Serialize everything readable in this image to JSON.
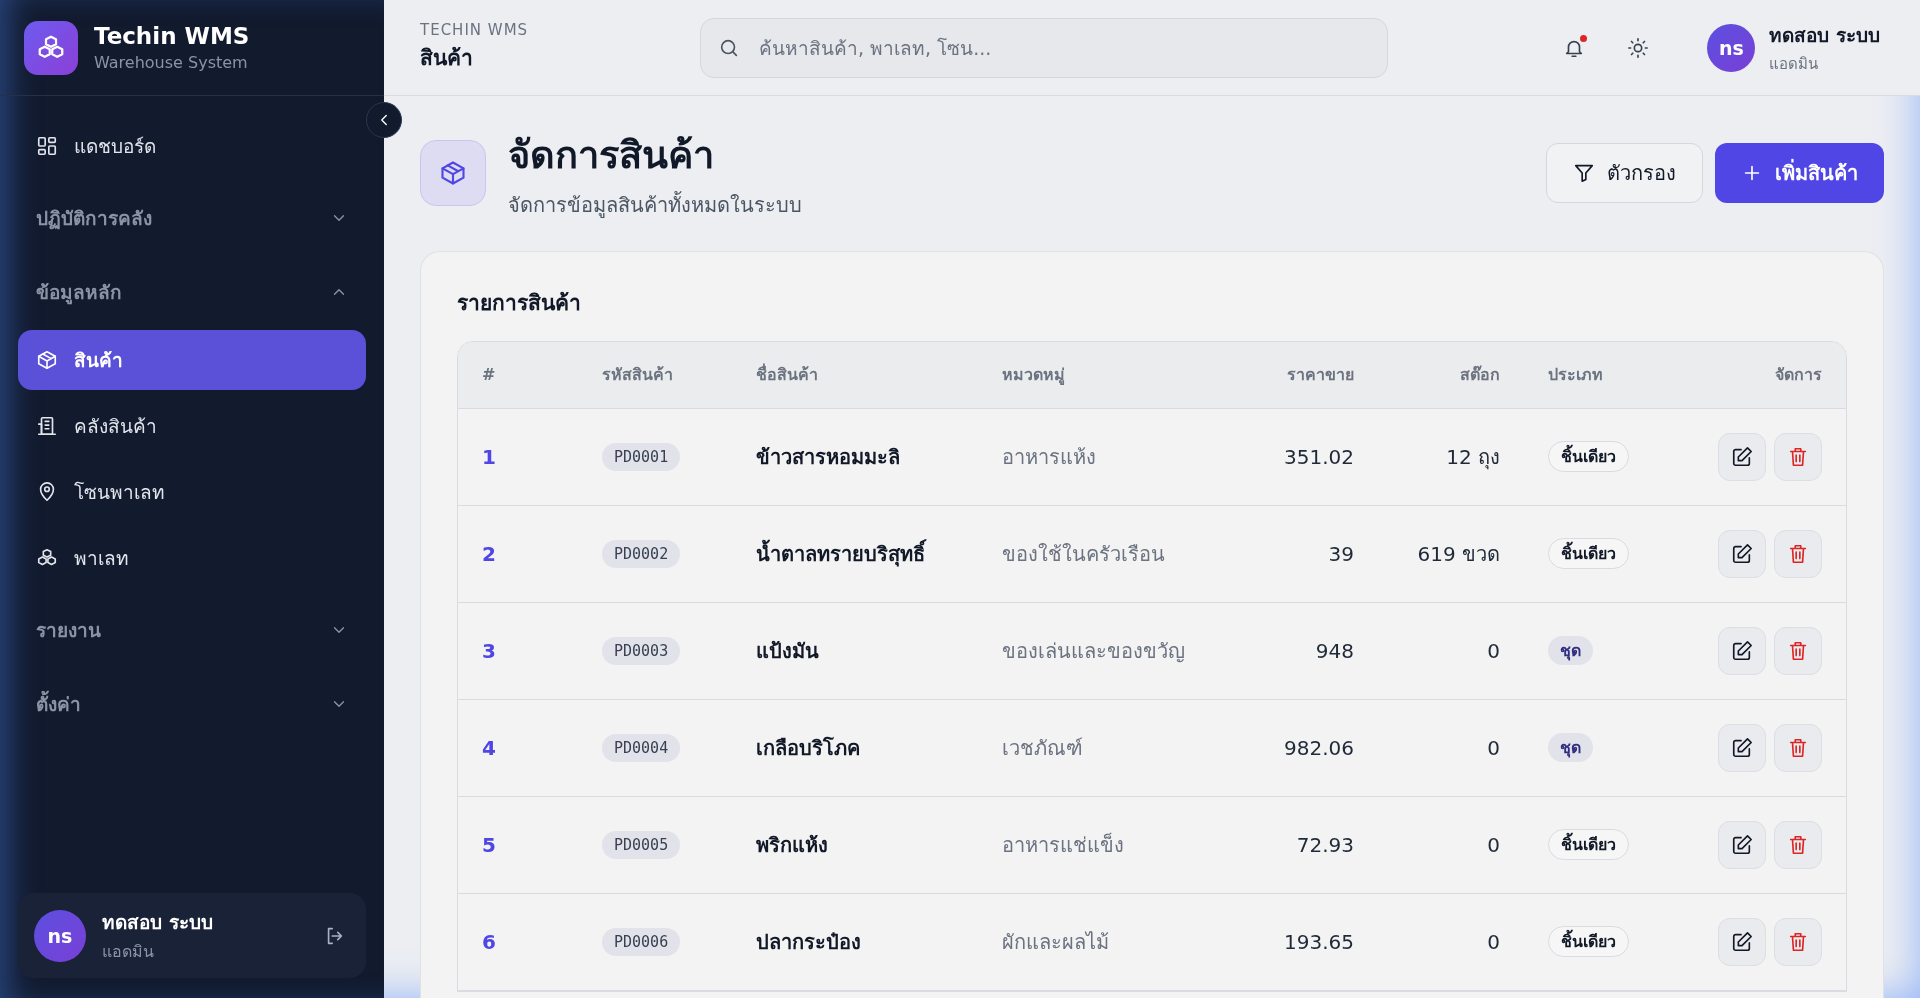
{
  "sidebar": {
    "brand": {
      "title": "Techin WMS",
      "subtitle": "Warehouse System"
    },
    "items": [
      {
        "kind": "link",
        "label": "แดชบอร์ด",
        "selected": false
      },
      {
        "kind": "group",
        "label": "ปฏิบัติการคลัง",
        "expanded": false
      },
      {
        "kind": "group",
        "label": "ข้อมูลหลัก",
        "expanded": true,
        "children": [
          {
            "label": "สินค้า",
            "selected": true
          },
          {
            "label": "คลังสินค้า",
            "selected": false
          },
          {
            "label": "โซนพาเลท",
            "selected": false
          },
          {
            "label": "พาเลท",
            "selected": false
          }
        ]
      },
      {
        "kind": "group",
        "label": "รายงาน",
        "expanded": false
      },
      {
        "kind": "group",
        "label": "ตั้งค่า",
        "expanded": false
      }
    ],
    "user": {
      "initials": "ns",
      "name": "ทดสอบ ระบบ",
      "role": "แอดมิน"
    }
  },
  "topbar": {
    "overline": "TECHIN WMS",
    "title": "สินค้า",
    "search": {
      "placeholder": "ค้นหาสินค้า, พาเลท, โซน..."
    },
    "unread": true,
    "user": {
      "initials": "ns",
      "name": "ทดสอบ ระบบ",
      "role": "แอดมิน"
    }
  },
  "page": {
    "title": "จัดการสินค้า",
    "subtitle": "จัดการข้อมูลสินค้าทั้งหมดในระบบ",
    "buttons": [
      {
        "label": "ตัวกรอง",
        "kind": "secondary"
      },
      {
        "label": "เพิ่มสินค้า",
        "kind": "primary"
      }
    ]
  },
  "table": {
    "title": "รายการสินค้า",
    "columns": [
      "#",
      "รหัสสินค้า",
      "ชื่อสินค้า",
      "หมวดหมู่",
      "ราคาขาย",
      "สต๊อก",
      "ประเภท",
      "จัดการ"
    ],
    "rows": [
      {
        "no": "1",
        "code": "PD0001",
        "name": "ข้าวสารหอมมะลิ",
        "category": "อาหารแห้ง",
        "price": "351.02",
        "stock": "12 ถุง",
        "type": {
          "label": "ชิ้นเดียว",
          "kind": "single"
        }
      },
      {
        "no": "2",
        "code": "PD0002",
        "name": "น้ำตาลทรายบริสุทธิ์",
        "category": "ของใช้ในครัวเรือน",
        "price": "39",
        "stock": "619 ขวด",
        "type": {
          "label": "ชิ้นเดียว",
          "kind": "single"
        }
      },
      {
        "no": "3",
        "code": "PD0003",
        "name": "แป้งมัน",
        "category": "ของเล่นและของขวัญ",
        "price": "948",
        "stock": "0",
        "type": {
          "label": "ชุด",
          "kind": "set"
        }
      },
      {
        "no": "4",
        "code": "PD0004",
        "name": "เกลือบริโภค",
        "category": "เวชภัณฑ์",
        "price": "982.06",
        "stock": "0",
        "type": {
          "label": "ชุด",
          "kind": "set"
        }
      },
      {
        "no": "5",
        "code": "PD0005",
        "name": "พริกแห้ง",
        "category": "อาหารแช่แข็ง",
        "price": "72.93",
        "stock": "0",
        "type": {
          "label": "ชิ้นเดียว",
          "kind": "single"
        }
      },
      {
        "no": "6",
        "code": "PD0006",
        "name": "ปลากระป๋อง",
        "category": "ผักและผลไม้",
        "price": "193.65",
        "stock": "0",
        "type": {
          "label": "ชิ้นเดียว",
          "kind": "single"
        }
      }
    ]
  }
}
